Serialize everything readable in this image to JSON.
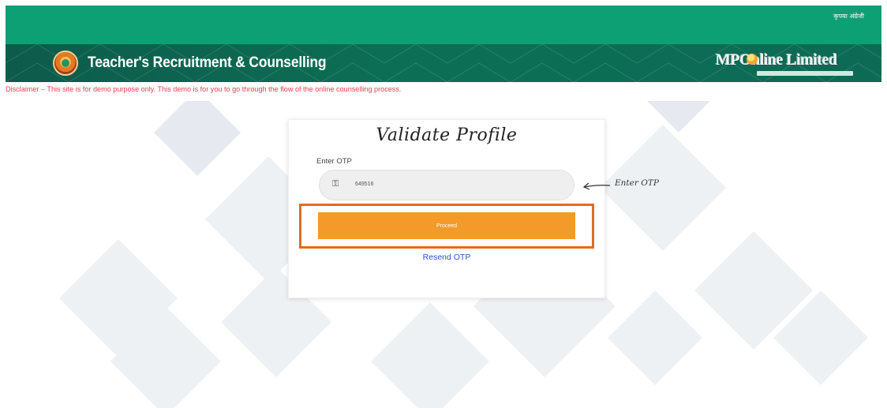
{
  "topbar": {
    "language_switch": "कृपया अंग्रेजी"
  },
  "header": {
    "title": "Teacher's Recruitment & Counselling",
    "logo_text": "MPOnline Limited"
  },
  "disclaimer": "Disclaimer – This site is for demo purpose only. This demo is for you to go through the flow of the online counselling process.",
  "card": {
    "title": "Validate Profile",
    "otp_label": "Enter OTP",
    "otp_value": "649516",
    "proceed_label": "Proceed",
    "resend_label": "Resend OTP"
  },
  "annotation": {
    "hint": "Enter OTP"
  },
  "colors": {
    "green_bar": "#0ea075",
    "header_green": "#0c6f55",
    "button_orange": "#f39a2a",
    "highlight_orange": "#e46a20",
    "link_blue": "#2d52c5",
    "disclaimer_red": "#ef3d4b"
  },
  "icons": {
    "emblem": "mp-emblem",
    "input_icon": "key-icon",
    "arrow": "pointer-arrow"
  }
}
